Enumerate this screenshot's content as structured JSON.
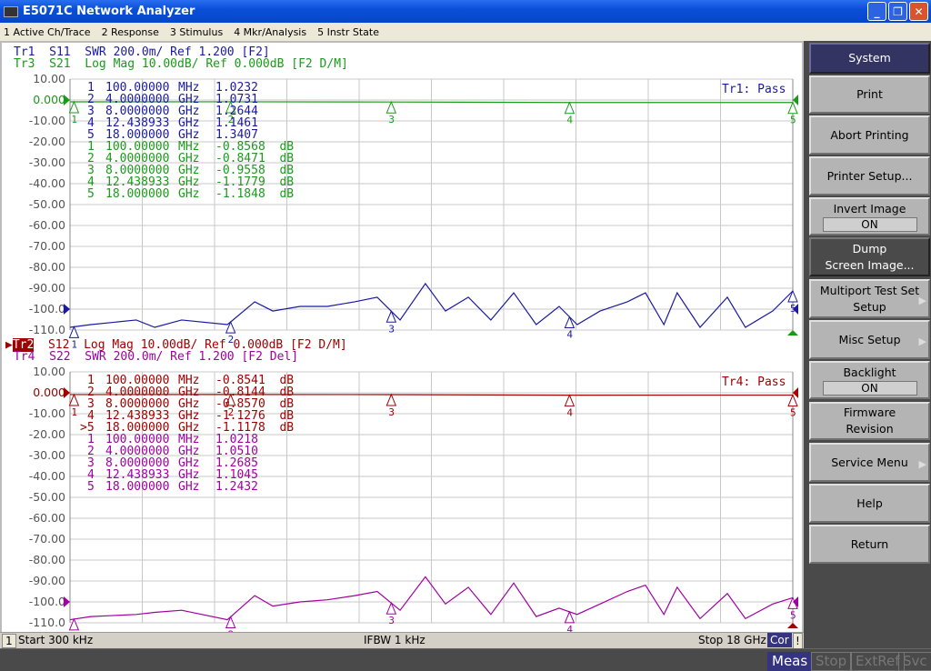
{
  "window": {
    "title": "E5071C Network Analyzer",
    "buttons": [
      "_",
      "❐",
      "✕"
    ]
  },
  "menu": [
    "1 Active Ch/Trace",
    "2 Response",
    "3 Stimulus",
    "4 Mkr/Analysis",
    "5 Instr State"
  ],
  "colors": {
    "tr1": "#1a1aa0",
    "tr3": "#1a9a1a",
    "tr2": "#a00000",
    "tr4": "#a000a0",
    "grid": "#c8c8c8"
  },
  "upper": {
    "traces": [
      {
        "label": "Tr1  S11  SWR 200.0m/ Ref 1.200 [F2]",
        "color": "#1a1aa0"
      },
      {
        "label": "Tr3  S21  Log Mag 10.00dB/ Ref 0.000dB [F2 D/M]",
        "color": "#1a9a1a"
      }
    ],
    "limit_status": "Tr1: Pass",
    "markers": [
      {
        "n": "1",
        "freq": "100.00000",
        "unit": "MHz",
        "val": "1.0232",
        "color": "#1a1aa0"
      },
      {
        "n": "2",
        "freq": "4.0000000",
        "unit": "GHz",
        "val": "1.0731",
        "color": "#1a1aa0"
      },
      {
        "n": "3",
        "freq": "8.0000000",
        "unit": "GHz",
        "val": "1.2644",
        "color": "#1a1aa0"
      },
      {
        "n": "4",
        "freq": "12.438933",
        "unit": "GHz",
        "val": "1.1461",
        "color": "#1a1aa0"
      },
      {
        "n": "5",
        "freq": "18.000000",
        "unit": "GHz",
        "val": "1.3407",
        "color": "#1a1aa0"
      },
      {
        "n": "1",
        "freq": "100.00000",
        "unit": "MHz",
        "val": "-0.8568  dB",
        "color": "#1a9a1a"
      },
      {
        "n": "2",
        "freq": "4.0000000",
        "unit": "GHz",
        "val": "-0.8471  dB",
        "color": "#1a9a1a"
      },
      {
        "n": "3",
        "freq": "8.0000000",
        "unit": "GHz",
        "val": "-0.9558  dB",
        "color": "#1a9a1a"
      },
      {
        "n": "4",
        "freq": "12.438933",
        "unit": "GHz",
        "val": "-1.1779  dB",
        "color": "#1a9a1a"
      },
      {
        "n": "5",
        "freq": "18.000000",
        "unit": "GHz",
        "val": "-1.1848  dB",
        "color": "#1a9a1a"
      }
    ]
  },
  "lower": {
    "traces": [
      {
        "label": "Tr2",
        "rest": "  S12  Log Mag 10.00dB/ Ref 0.000dB [F2 D/M]",
        "color": "#a00000"
      },
      {
        "label": "Tr4  S22  SWR 200.0m/ Ref 1.200 [F2 Del]",
        "color": "#a000a0"
      }
    ],
    "limit_status": "Tr4: Pass",
    "markers": [
      {
        "n": "1",
        "freq": "100.00000",
        "unit": "MHz",
        "val": "-0.8541  dB",
        "color": "#a00000"
      },
      {
        "n": "2",
        "freq": "4.0000000",
        "unit": "GHz",
        "val": "-0.8144  dB",
        "color": "#a00000"
      },
      {
        "n": "3",
        "freq": "8.0000000",
        "unit": "GHz",
        "val": "-0.8570  dB",
        "color": "#a00000"
      },
      {
        "n": "4",
        "freq": "12.438933",
        "unit": "GHz",
        "val": "-1.1276  dB",
        "color": "#a00000"
      },
      {
        "n": ">5",
        "freq": "18.000000",
        "unit": "GHz",
        "val": "-1.1178  dB",
        "color": "#a00000"
      },
      {
        "n": "1",
        "freq": "100.00000",
        "unit": "MHz",
        "val": "1.0218",
        "color": "#a000a0"
      },
      {
        "n": "2",
        "freq": "4.0000000",
        "unit": "GHz",
        "val": "1.0510",
        "color": "#a000a0"
      },
      {
        "n": "3",
        "freq": "8.0000000",
        "unit": "GHz",
        "val": "1.2685",
        "color": "#a000a0"
      },
      {
        "n": "4",
        "freq": "12.438933",
        "unit": "GHz",
        "val": "1.1045",
        "color": "#a000a0"
      },
      {
        "n": "5",
        "freq": "18.000000",
        "unit": "GHz",
        "val": "1.2432",
        "color": "#a000a0"
      }
    ]
  },
  "chart_data": [
    {
      "type": "line",
      "ylim": [
        -110,
        10
      ],
      "xlim_ghz": [
        0.0003,
        18
      ],
      "grid": true,
      "yticks": [
        "10.00",
        "0.000",
        "-10.00",
        "-20.00",
        "-30.00",
        "-40.00",
        "-50.00",
        "-60.00",
        "-70.00",
        "-80.00",
        "-90.00",
        "-100.0",
        "-110.0"
      ],
      "marker_freqs_ghz": [
        0.1,
        4,
        8,
        12.438933,
        18
      ],
      "series": [
        {
          "name": "Tr1",
          "color": "#1a1aa0",
          "x": [
            0,
            0.52,
            1.65,
            2.11,
            2.78,
            3.92,
            4.6,
            5.05,
            5.73,
            6.41,
            7.09,
            7.65,
            8.22,
            8.85,
            9.35,
            9.92,
            10.48,
            11.05,
            11.61,
            12.18,
            12.63,
            13.2,
            13.88,
            14.33,
            14.79,
            15.12,
            15.69,
            16.37,
            16.82,
            17.5,
            18
          ],
          "y": [
            -108.7,
            -107.4,
            -105.2,
            -108.7,
            -105.2,
            -107.4,
            -96.5,
            -100.9,
            -98.7,
            -98.7,
            -96.5,
            -94.3,
            -105.2,
            -87.8,
            -100.9,
            -94.3,
            -105.2,
            -92.2,
            -107.4,
            -98.7,
            -107.4,
            -100.9,
            -96.5,
            -92.2,
            -107.4,
            -92.2,
            -108.7,
            -94.3,
            -108.7,
            -100.9,
            -91.3
          ]
        },
        {
          "name": "Tr3",
          "color": "#1a9a1a",
          "x": [
            0,
            4,
            8,
            12.44,
            18
          ],
          "y": [
            -0.86,
            -0.85,
            -0.96,
            -1.18,
            -1.18
          ]
        }
      ]
    },
    {
      "type": "line",
      "ylim": [
        -110,
        10
      ],
      "xlim_ghz": [
        0.0003,
        18
      ],
      "grid": true,
      "yticks": [
        "10.00",
        "0.000",
        "-10.00",
        "-20.00",
        "-30.00",
        "-40.00",
        "-50.00",
        "-60.00",
        "-70.00",
        "-80.00",
        "-90.00",
        "-100.0",
        "-110.0"
      ],
      "marker_freqs_ghz": [
        0.1,
        4,
        8,
        12.438933,
        18
      ],
      "series": [
        {
          "name": "Tr4",
          "color": "#a000a0",
          "x": [
            0,
            0.52,
            1.65,
            2.11,
            2.78,
            3.92,
            4.6,
            5.05,
            5.73,
            6.41,
            7.09,
            7.65,
            8.22,
            8.85,
            9.35,
            9.92,
            10.48,
            11.05,
            11.61,
            12.18,
            12.63,
            13.2,
            13.88,
            14.33,
            14.79,
            15.12,
            15.69,
            16.37,
            16.82,
            17.5,
            18
          ],
          "y": [
            -108.5,
            -107,
            -106,
            -105,
            -104,
            -108.5,
            -97,
            -102,
            -100,
            -99,
            -97,
            -95,
            -104,
            -88,
            -101,
            -93,
            -106,
            -91,
            -107,
            -103,
            -106,
            -101,
            -95,
            -92,
            -106,
            -93,
            -108,
            -96,
            -108,
            -101,
            -98
          ]
        },
        {
          "name": "Tr2",
          "color": "#a00000",
          "x": [
            0,
            4,
            8,
            12.44,
            18
          ],
          "y": [
            -0.85,
            -0.81,
            -0.86,
            -1.13,
            -1.12
          ]
        }
      ]
    }
  ],
  "status": {
    "channel": "1",
    "start": "Start 300 kHz",
    "ifbw": "IFBW 1 kHz",
    "stop": "Stop 18 GHz",
    "cor": "Cor",
    "warn": "!"
  },
  "bottom": {
    "meas": "Meas",
    "stop": "Stop",
    "extref": "ExtRef",
    "svc": "Svc"
  },
  "softkeys": {
    "title": "System",
    "print": "Print",
    "abort": "Abort Printing",
    "printer_setup": "Printer Setup...",
    "invert_label": "Invert Image",
    "invert_val": "ON",
    "dump1": "Dump",
    "dump2": "Screen Image...",
    "multiport1": "Multiport Test Set",
    "multiport2": "Setup",
    "misc": "Misc Setup",
    "backlight_label": "Backlight",
    "backlight_val": "ON",
    "firmware1": "Firmware",
    "firmware2": "Revision",
    "service": "Service Menu",
    "help": "Help",
    "return": "Return"
  }
}
